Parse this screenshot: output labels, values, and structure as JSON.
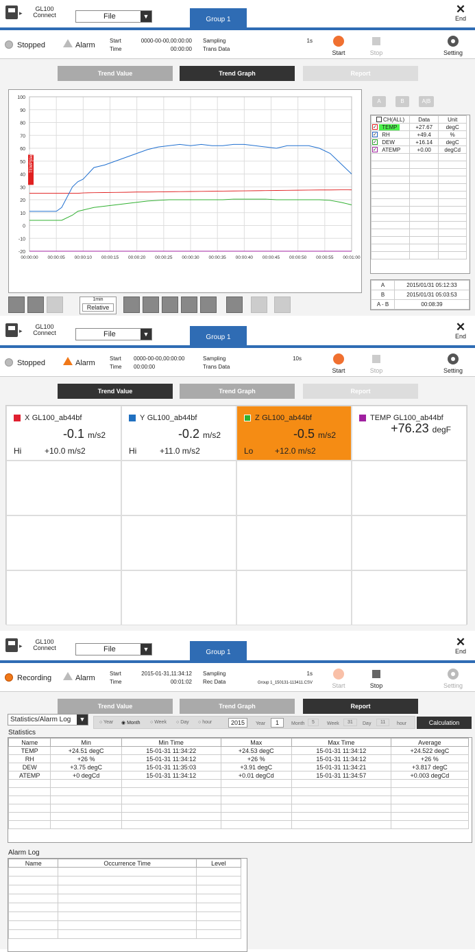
{
  "header": {
    "app_line1": "GL100",
    "app_line2": "Connect",
    "file_label": "File",
    "group_tab": "Group 1",
    "end_label": "End"
  },
  "panel1": {
    "status": "Stopped",
    "alarm": "Alarm",
    "start_label": "Start",
    "start_value": "0000-00-00,00:00:00",
    "time_label": "Time",
    "time_value": "00:00:00",
    "sampling_label": "Sampling",
    "sampling_value": "1s",
    "trans_label": "Trans Data",
    "start_btn": "Start",
    "stop_btn": "Stop",
    "setting_btn": "Setting",
    "modes": [
      "Trend Value",
      "Trend Graph",
      "Report"
    ],
    "zoom_value": "1min",
    "zoom_mode": "Relative",
    "ab_buttons": [
      "A",
      "B",
      "A|B"
    ],
    "channel_table": {
      "headers": [
        "CH(ALL)",
        "Data",
        "Unit"
      ],
      "rows": [
        {
          "name": "TEMP",
          "data": "+27.67",
          "unit": "degC",
          "color": "#e02020"
        },
        {
          "name": "RH",
          "data": "+49.4",
          "unit": "%",
          "color": "#2060c0"
        },
        {
          "name": "DEW",
          "data": "+16.14",
          "unit": "degC",
          "color": "#20a020"
        },
        {
          "name": "ATEMP",
          "data": "+0.00",
          "unit": "degCd",
          "color": "#a020a0"
        }
      ]
    },
    "ab_table": [
      {
        "k": "A",
        "v": "2015/01/31 05:12:33"
      },
      {
        "k": "B",
        "v": "2015/01/31 05:03:53"
      },
      {
        "k": "A - B",
        "v": "00:08:39"
      }
    ]
  },
  "chart_data": {
    "type": "line",
    "ylabel": "TEMP[degC]",
    "ylim": [
      -20,
      100
    ],
    "yticks": [
      100,
      90,
      80,
      70,
      60,
      50,
      40,
      30,
      20,
      10,
      0,
      -10,
      -20
    ],
    "xticks": [
      "00:00:00",
      "00:00:05",
      "00:00:10",
      "00:00:15",
      "00:00:20",
      "00:00:25",
      "00:00:30",
      "00:00:35",
      "00:00:40",
      "00:00:45",
      "00:00:50",
      "00:00:55",
      "00:01:00"
    ],
    "x": [
      0,
      3,
      5,
      6,
      8,
      9,
      10,
      12,
      14,
      16,
      18,
      20,
      22,
      24,
      26,
      28,
      30,
      32,
      34,
      36,
      38,
      40,
      42,
      44,
      46,
      48,
      50,
      52,
      54,
      56,
      58,
      60
    ],
    "grid": true,
    "series": [
      {
        "name": "TEMP",
        "color": "#e02020",
        "values": [
          25,
          25,
          25,
          25,
          25,
          25,
          25.3,
          25.5,
          25.6,
          25.7,
          25.8,
          26,
          26,
          26.1,
          26.2,
          26.3,
          26.4,
          26.5,
          26.6,
          26.7,
          26.8,
          26.9,
          27,
          27.1,
          27.2,
          27.3,
          27.4,
          27.5,
          27.6,
          27.6,
          27.7,
          27.7
        ]
      },
      {
        "name": "RH",
        "color": "#2070d0",
        "values": [
          11,
          11,
          11,
          14,
          30,
          34,
          36,
          45,
          47,
          50,
          53,
          56,
          59,
          61,
          62,
          63,
          62,
          63,
          62,
          62,
          63,
          63,
          62,
          61,
          60,
          62,
          62,
          62,
          60,
          56,
          48,
          40
        ]
      },
      {
        "name": "DEW",
        "color": "#30b030",
        "values": [
          4,
          4,
          4,
          4,
          8,
          11,
          12,
          14,
          15,
          16,
          17,
          18,
          19,
          19.5,
          20,
          20,
          20,
          20,
          20,
          20,
          20.5,
          20.5,
          20.5,
          20.5,
          20,
          20,
          20,
          20,
          20,
          19.5,
          18,
          16
        ]
      },
      {
        "name": "ATEMP",
        "color": "#a020a0",
        "values": [
          -20,
          -20,
          -20,
          -20,
          -20,
          -20,
          -20,
          -20,
          -20,
          -20,
          -20,
          -20,
          -20,
          -20,
          -20,
          -20,
          -20,
          -20,
          -20,
          -20,
          -20,
          -20,
          -20,
          -20,
          -20,
          -20,
          -20,
          -20,
          -20,
          -20,
          -20,
          -20
        ]
      }
    ]
  },
  "panel2": {
    "status": "Stopped",
    "alarm": "Alarm",
    "start_label": "Start",
    "start_value": "0000-00-00,00:00:00",
    "time_label": "Time",
    "time_value": "00:00:00",
    "sampling_label": "Sampling",
    "sampling_value": "10s",
    "trans_label": "Trans Data",
    "cells": [
      {
        "ch": "X",
        "dev": "GL100_ab44bf",
        "value": "-0.1",
        "unit": "m/s2",
        "lim_label": "Hi",
        "lim_value": "+10.0 m/s2",
        "color": "#e02030"
      },
      {
        "ch": "Y",
        "dev": "GL100_ab44bf",
        "value": "-0.2",
        "unit": "m/s2",
        "lim_label": "Hi",
        "lim_value": "+11.0 m/s2",
        "color": "#2070c0"
      },
      {
        "ch": "Z",
        "dev": "GL100_ab44bf",
        "value": "-0.5",
        "unit": "m/s2",
        "lim_label": "Lo",
        "lim_value": "+12.0 m/s2",
        "color": "#30b030"
      },
      {
        "ch": "TEMP",
        "dev": "GL100_ab44bf",
        "value": "+76.23",
        "unit": "degF",
        "lim_label": "",
        "lim_value": "",
        "color": "#a020a0"
      }
    ]
  },
  "panel3": {
    "status": "Recording",
    "alarm": "Alarm",
    "start_label": "Start",
    "start_value": "2015-01-31,11:34:12",
    "time_label": "Time",
    "time_value": "00:01:02",
    "sampling_label": "Sampling",
    "sampling_value": "1s",
    "rec_label": "Rec Data",
    "rec_file": "Group 1_150131-113411.CSV",
    "report_type": "Statistics/Alarm Log",
    "filters": [
      "Year",
      "Month",
      "Week",
      "Day",
      "hour"
    ],
    "year": "2015",
    "year_u": "Year",
    "month": "1",
    "month_u": "Month",
    "week": "5",
    "week_u": "Week",
    "day": "31",
    "day_u": "Day",
    "hour": "11",
    "hour_u": "hour",
    "calc": "Calculation",
    "stats_title": "Statistics",
    "stats_headers": [
      "Name",
      "Min",
      "Min Time",
      "Max",
      "Max Time",
      "Average"
    ],
    "stats_rows": [
      [
        "TEMP",
        "+24.51 degC",
        "15-01-31 11:34:22",
        "+24.53 degC",
        "15-01-31 11:34:12",
        "+24.522 degC"
      ],
      [
        "RH",
        "+26 %",
        "15-01-31 11:34:12",
        "+26 %",
        "15-01-31 11:34:12",
        "+26 %"
      ],
      [
        "DEW",
        "+3.75 degC",
        "15-01-31 11:35:03",
        "+3.91 degC",
        "15-01-31 11:34:21",
        "+3.817 degC"
      ],
      [
        "ATEMP",
        "+0 degCd",
        "15-01-31 11:34:12",
        "+0.01 degCd",
        "15-01-31 11:34:57",
        "+0.003 degCd"
      ]
    ],
    "alarm_title": "Alarm Log",
    "alarm_headers": [
      "Name",
      "Occurrence Time",
      "Level"
    ]
  }
}
